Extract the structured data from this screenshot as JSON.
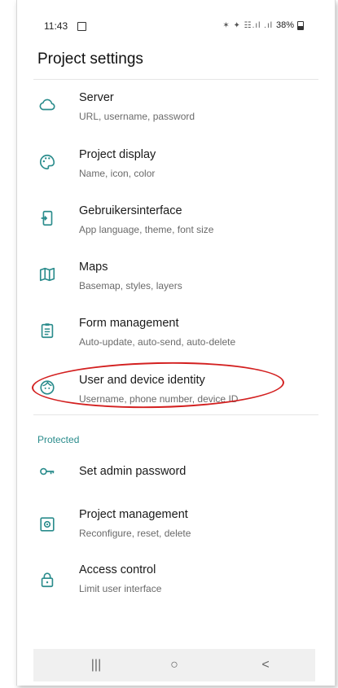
{
  "status_bar": {
    "time": "11:43",
    "signal_text": "✶ ✦ ☷.ıl .ıl",
    "battery": "38%"
  },
  "title": "Project settings",
  "items": [
    {
      "title": "Server",
      "subtitle": "URL, username, password",
      "icon": "cloud-icon"
    },
    {
      "title": "Project display",
      "subtitle": "Name, icon, color",
      "icon": "palette-icon"
    },
    {
      "title": "Gebruikersinterface",
      "subtitle": "App language, theme, font size",
      "icon": "phone-icon"
    },
    {
      "title": "Maps",
      "subtitle": "Basemap, styles, layers",
      "icon": "map-icon"
    },
    {
      "title": "Form management",
      "subtitle": "Auto-update, auto-send, auto-delete",
      "icon": "clipboard-icon"
    },
    {
      "title": "User and device identity",
      "subtitle": "Username, phone number, device ID",
      "icon": "face-icon"
    }
  ],
  "protected_section": {
    "header": "Protected",
    "items": [
      {
        "title": "Set admin password",
        "subtitle": "",
        "icon": "key-icon"
      },
      {
        "title": "Project management",
        "subtitle": "Reconfigure, reset, delete",
        "icon": "settings-box-icon"
      },
      {
        "title": "Access control",
        "subtitle": "Limit user interface",
        "icon": "lock-icon"
      }
    ]
  },
  "colors": {
    "accent": "#2a8c8c",
    "highlight": "#d32020"
  },
  "nav_bar": {
    "recent": "|||",
    "home": "○",
    "back": "<"
  }
}
